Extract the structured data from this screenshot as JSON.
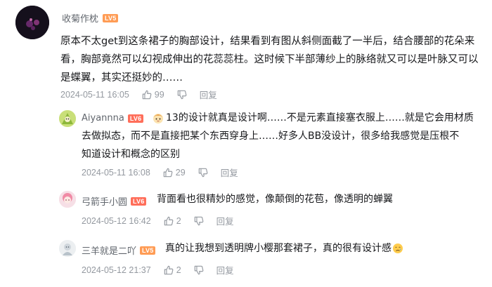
{
  "comment": {
    "user": "收菊作枕",
    "level": "LV5",
    "lines": [
      "原本不太get到这条裙子的胸部设计，结果看到有图从斜侧面截了一半后，结合腰部的花朵来",
      "看，胸部竟然可以幻视成伸出的花蕊蕊柱。这时候下半部薄纱上的脉络就又可以是叶脉又可以",
      "是蝶翼，其实还挺妙的……"
    ],
    "time": "2024-05-11 16:05",
    "likes": "99",
    "reply_label": "回复"
  },
  "replies": [
    {
      "user": "Aiyannna",
      "level": "LV6",
      "lines": [
        "13的设计就真是设计啊……不是元素直接塞衣服上……就是它会用材质",
        "去做拟态，而不是直接把某个东西穿身上……好多人BB没设计，很多给我感觉是压根不",
        "知道设计和概念的区别"
      ],
      "time": "2024-05-11 16:08",
      "likes": "29",
      "reply_label": "回复"
    },
    {
      "user": "弓箭手小圆",
      "level": "LV6",
      "text": "背面看也很精妙的感觉，像颠倒的花苞，像透明的蝉翼",
      "time": "2024-05-12 16:42",
      "likes": "2",
      "reply_label": "回复"
    },
    {
      "user": "三羊就是二吖",
      "level": "LV5",
      "text": "真的让我想到透明牌小樱那套裙子，真的很有设计感",
      "emoji": "😢",
      "time": "2024-05-12 21:37",
      "likes": "2",
      "reply_label": "回复"
    }
  ],
  "icons": {
    "like": "thumbs-up-icon",
    "dislike": "thumbs-down-icon",
    "emoji": "cute-face-emoji-icon"
  },
  "colors": {
    "lv5": "#ff9c55",
    "lv6": "#ff6e5a",
    "meta": "#9499a0",
    "username": "#61666d"
  }
}
